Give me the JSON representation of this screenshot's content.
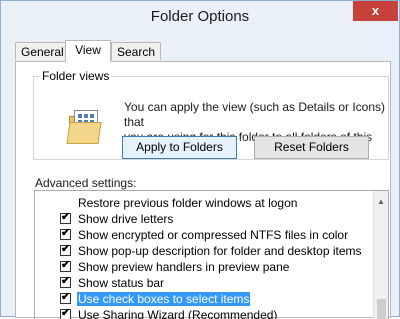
{
  "window": {
    "title": "Folder Options",
    "close_symbol": "x"
  },
  "tabs": [
    {
      "label": "General",
      "active": false
    },
    {
      "label": "View",
      "active": true
    },
    {
      "label": "Search",
      "active": false
    }
  ],
  "folder_views": {
    "legend": "Folder views",
    "icon": "folder-views-icon",
    "description_line1": "You can apply the view (such as Details or Icons) that",
    "description_line2": "you are using for this folder to all folders of this type.",
    "apply_label": "Apply to Folders",
    "reset_label": "Reset Folders"
  },
  "advanced": {
    "label": "Advanced settings:",
    "items": [
      {
        "label": "Restore previous folder windows at logon",
        "checked": false,
        "selected": false
      },
      {
        "label": "Show drive letters",
        "checked": true,
        "selected": false
      },
      {
        "label": "Show encrypted or compressed NTFS files in color",
        "checked": true,
        "selected": false
      },
      {
        "label": "Show pop-up description for folder and desktop items",
        "checked": true,
        "selected": false
      },
      {
        "label": "Show preview handlers in preview pane",
        "checked": true,
        "selected": false
      },
      {
        "label": "Show status bar",
        "checked": true,
        "selected": false
      },
      {
        "label": "Use check boxes to select items",
        "checked": true,
        "selected": true
      },
      {
        "label": "Use Sharing Wizard (Recommended)",
        "checked": true,
        "selected": false
      }
    ]
  },
  "colors": {
    "selection": "#3399ff",
    "close_button": "#c7413a"
  }
}
